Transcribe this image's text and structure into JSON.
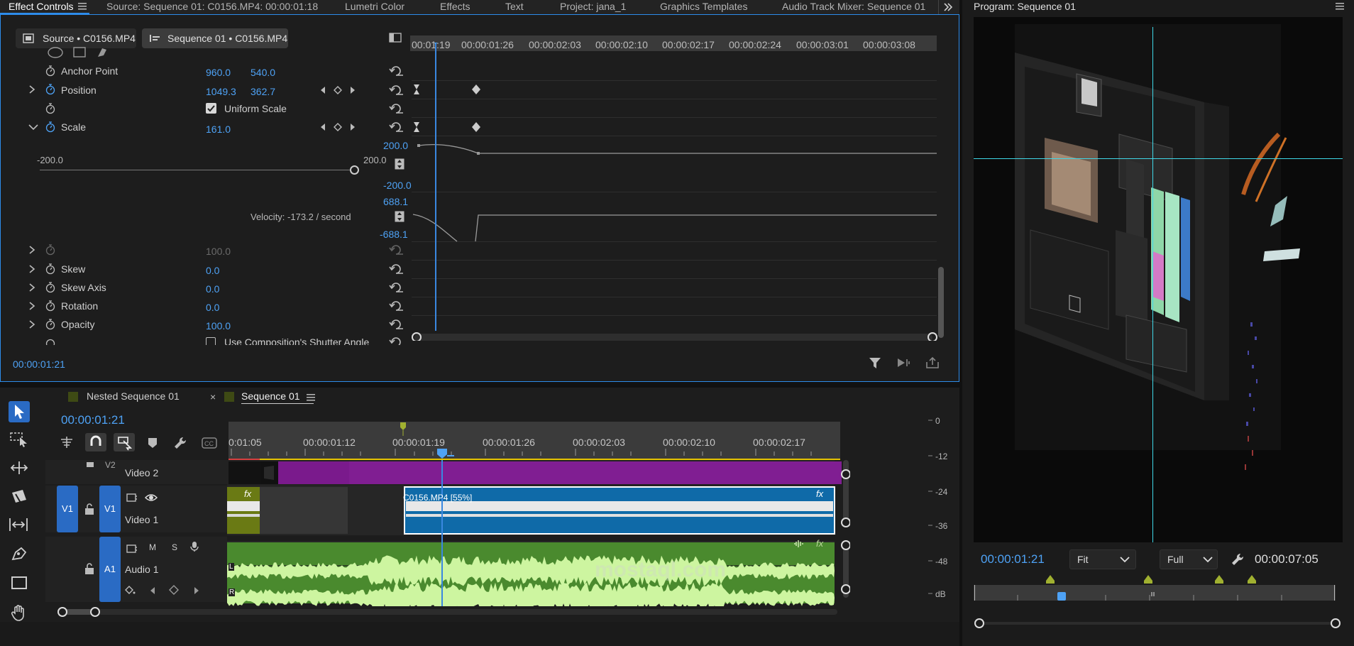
{
  "tabs": [
    {
      "label": "Effect Controls",
      "active": true
    },
    {
      "label": "Source: Sequence 01: C0156.MP4: 00:00:01:18"
    },
    {
      "label": "Lumetri Color"
    },
    {
      "label": "Effects"
    },
    {
      "label": "Text"
    },
    {
      "label": "Project: jana_1"
    },
    {
      "label": "Graphics Templates"
    },
    {
      "label": "Audio Track Mixer: Sequence 01"
    }
  ],
  "effect_controls": {
    "source_pill": "Source • C0156.MP4",
    "sequence_pill": "Sequence 01 • C0156.MP4",
    "properties": {
      "anchor_point": {
        "label": "Anchor Point",
        "x": "960.0",
        "y": "540.0"
      },
      "position": {
        "label": "Position",
        "x": "1049.3",
        "y": "362.7"
      },
      "uniform_scale": {
        "label": "Uniform Scale",
        "checked": true
      },
      "scale": {
        "label": "Scale",
        "value": "161.0"
      },
      "scale_width": {
        "value": "100.0"
      },
      "skew": {
        "label": "Skew",
        "value": "0.0"
      },
      "skew_axis": {
        "label": "Skew Axis",
        "value": "0.0"
      },
      "rotation": {
        "label": "Rotation",
        "value": "0.0"
      },
      "opacity": {
        "label": "Opacity",
        "value": "100.0"
      },
      "shutter": {
        "label": "Use Composition's Shutter Angle"
      }
    },
    "graph": {
      "value_max": "200.0",
      "value_min": "-200.0",
      "slider_min": "-200.0",
      "slider_max": "200.0",
      "velocity_max": "688.1",
      "velocity_min": "-688.1",
      "velocity_label": "Velocity: -173.2 / second"
    },
    "ruler_ticks": [
      "00:01:19",
      "00:00:01:26",
      "00:00:02:03",
      "00:00:02:10",
      "00:00:02:17",
      "00:00:02:24",
      "00:00:03:01",
      "00:00:03:08"
    ],
    "timecode": "00:00:01:21"
  },
  "program": {
    "title": "Program: Sequence 01",
    "timecode": "00:00:01:21",
    "fit": "Fit",
    "quality": "Full",
    "duration": "00:00:07:05"
  },
  "timeline": {
    "tabs": [
      "Nested Sequence 01",
      "Sequence 01"
    ],
    "timecode": "00:00:01:21",
    "ruler_ticks": [
      "0:01:05",
      "00:00:01:12",
      "00:00:01:19",
      "00:00:01:26",
      "00:00:02:03",
      "00:00:02:10",
      "00:00:02:17"
    ],
    "tracks": {
      "v2": {
        "id": "V2",
        "name": "Video 2"
      },
      "v1": {
        "id": "V1",
        "name": "Video 1"
      },
      "a1": {
        "id": "A1",
        "name": "Audio 1"
      }
    },
    "clip_label": "C0156.MP4 [55%]",
    "fx": "fx",
    "m": "M",
    "s": "S",
    "l": "L",
    "r": "R"
  },
  "meter": {
    "labels": [
      "0",
      "-12",
      "-24",
      "-36",
      "-48",
      "dB"
    ]
  },
  "watermark": {
    "text": "mostaql.com"
  },
  "colors": {
    "accent": "#2d8ceb",
    "clip_video": "#0f6aa8",
    "clip_purple": "#7a1a8c",
    "audio_green": "#4a8a2e",
    "waveform": "#cdf5a0"
  }
}
